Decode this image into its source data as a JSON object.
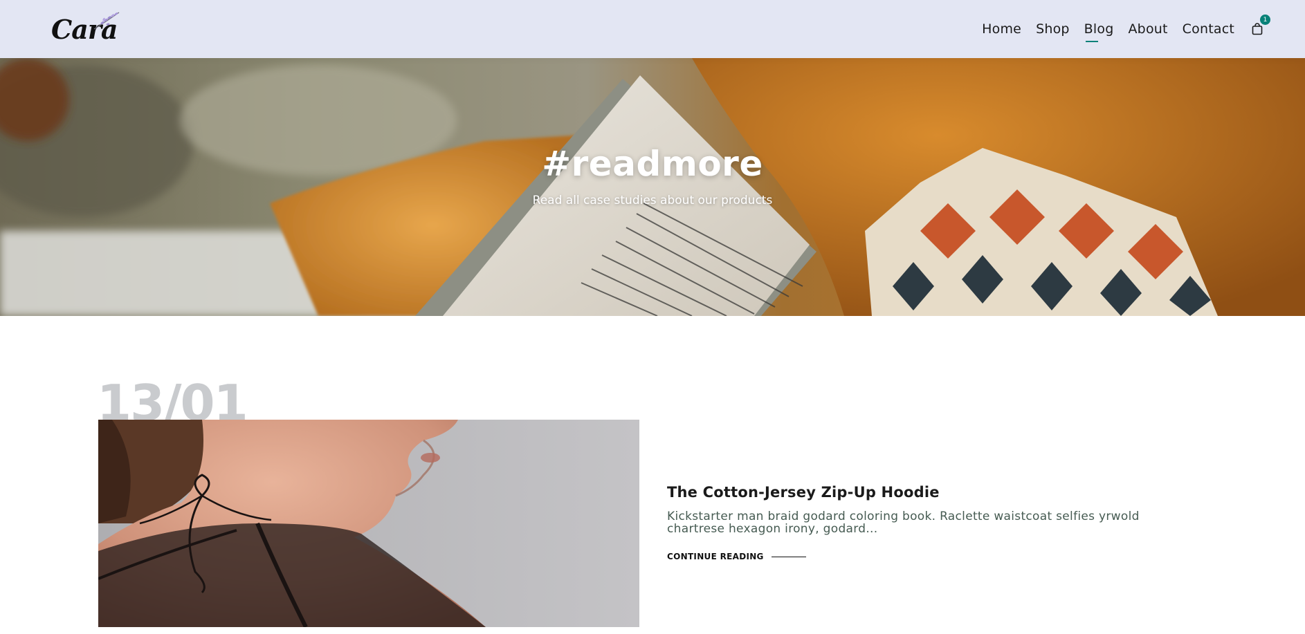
{
  "header": {
    "logo_text": "Cara",
    "nav": [
      {
        "label": "Home",
        "active": false
      },
      {
        "label": "Shop",
        "active": false
      },
      {
        "label": "Blog",
        "active": true
      },
      {
        "label": "About",
        "active": false
      },
      {
        "label": "Contact",
        "active": false
      }
    ],
    "cart_count": "1",
    "cart_icon": "shopping-bag-icon"
  },
  "hero": {
    "title": "#readmore",
    "subtitle": "Read all case studies about our products"
  },
  "posts": [
    {
      "date": "13/01",
      "title": "The Cotton-Jersey Zip-Up Hoodie",
      "excerpt": "Kickstarter man braid godard coloring book. Raclette waistcoat selfies yrwold chartrese hexagon irony, godard...",
      "link_label": "CONTINUE READING"
    }
  ],
  "colors": {
    "header_bg": "#e3e6f3",
    "accent": "#088178",
    "date_gray": "#c9cbce",
    "excerpt": "#465b52"
  }
}
